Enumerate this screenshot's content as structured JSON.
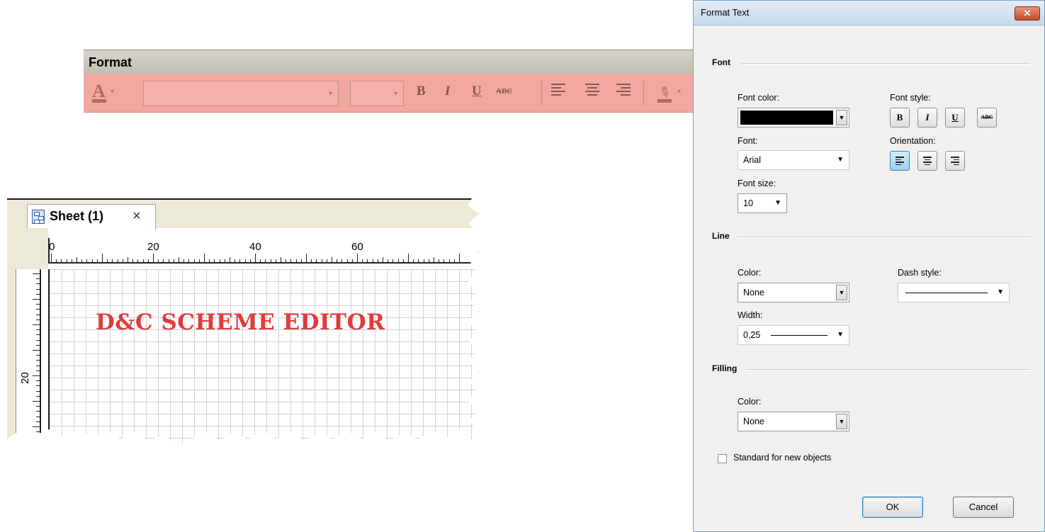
{
  "toolbar": {
    "title": "Format",
    "font_color_icon": "font-color-icon",
    "bold_label": "B",
    "italic_label": "I",
    "underline_label": "U",
    "strike_label": "ABC",
    "colors": {
      "strip": "#f2a79f",
      "title_bar": "#c2beb3"
    }
  },
  "sheet": {
    "tab_label": "Sheet (1)",
    "tab_close": "×",
    "ruler_top_labels": [
      "0",
      "20",
      "40",
      "60"
    ],
    "ruler_left_labels": [
      "20"
    ],
    "canvas_text": "D&C SCHEME EDITOR",
    "canvas_text_color": "#e03b3d"
  },
  "dialog": {
    "title": "Format Text",
    "close_label": "✕",
    "font_section": {
      "heading": "Font",
      "font_color_label": "Font color:",
      "font_color_value": "#000000",
      "font_style_label": "Font style:",
      "style_buttons": [
        "B",
        "I",
        "U",
        "ABC"
      ],
      "font_label": "Font:",
      "font_value": "Arial",
      "orientation_label": "Orientation:",
      "orientation_selected": "left",
      "font_size_label": "Font size:",
      "font_size_value": "10"
    },
    "line_section": {
      "heading": "Line",
      "color_label": "Color:",
      "color_value": "None",
      "dash_style_label": "Dash style:",
      "width_label": "Width:",
      "width_value": "0,25"
    },
    "filling_section": {
      "heading": "Filling",
      "color_label": "Color:",
      "color_value": "None"
    },
    "standard_checkbox_label": "Standard for new objects",
    "standard_checked": false,
    "ok_label": "OK",
    "cancel_label": "Cancel"
  }
}
